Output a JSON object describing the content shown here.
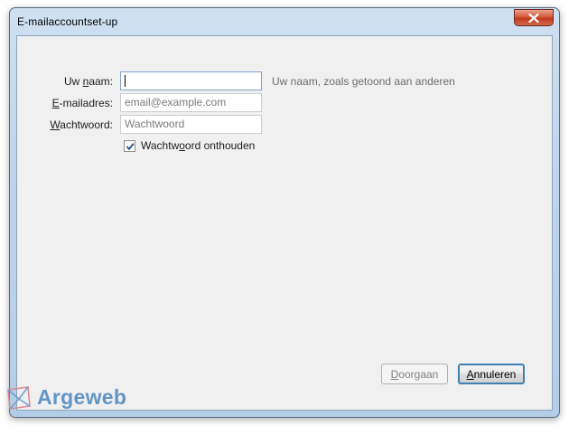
{
  "window": {
    "title": "E-mailaccountset-up"
  },
  "form": {
    "name_label": "Uw naam:",
    "name_label_pre": "Uw ",
    "name_label_accel": "n",
    "name_label_post": "aam:",
    "name_value": "",
    "name_hint": "Uw naam, zoals getoond aan anderen",
    "email_label_accel": "E",
    "email_label_post": "-mailadres:",
    "email_placeholder": "email@example.com",
    "password_label_accel": "W",
    "password_label_post": "achtwoord:",
    "password_placeholder": "Wachtwoord",
    "remember_label_pre": "Wachtw",
    "remember_label_accel": "o",
    "remember_label_post": "ord onthouden",
    "remember_checked": true
  },
  "buttons": {
    "continue_pre": "",
    "continue_accel": "D",
    "continue_post": "oorgaan",
    "cancel_accel": "A",
    "cancel_post": "nnuleren"
  },
  "watermark": {
    "text": "Argeweb"
  },
  "colors": {
    "accent": "#3c7fb1",
    "watermark": "#4a86bf",
    "close_button": "#c13a1c"
  }
}
